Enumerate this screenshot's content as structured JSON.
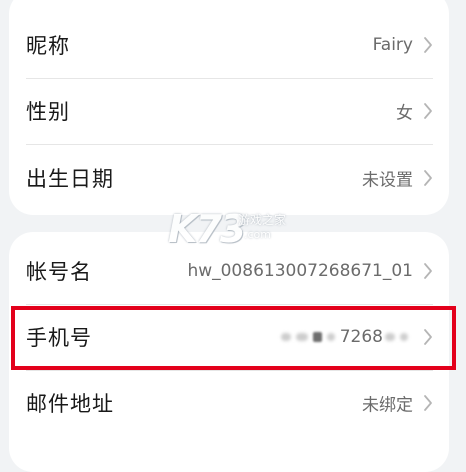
{
  "profile": {
    "nickname": {
      "label": "昵称",
      "value": "Fairy"
    },
    "gender": {
      "label": "性别",
      "value": "女"
    },
    "birthday": {
      "label": "出生日期",
      "value": "未设置"
    }
  },
  "account": {
    "account_name": {
      "label": "帐号名",
      "value": "hw_008613007268671_01"
    },
    "phone": {
      "label": "手机号",
      "value": "7268"
    },
    "email": {
      "label": "邮件地址",
      "value": "未绑定"
    }
  },
  "watermark": {
    "logo": "K73",
    "site_cn": "游戏之家",
    "site_domain": ".com"
  },
  "colors": {
    "highlight_border": "#e3001b",
    "background": "#f1f3f5",
    "card": "#ffffff"
  },
  "icons": {
    "row_chevron": "chevron-right-icon"
  }
}
